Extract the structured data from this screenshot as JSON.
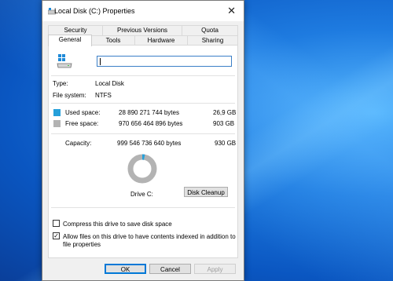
{
  "window": {
    "title": "Local Disk (C:) Properties"
  },
  "tabs_row1": [
    "Security",
    "Previous Versions",
    "Quota"
  ],
  "tabs_row2": [
    "General",
    "Tools",
    "Hardware",
    "Sharing"
  ],
  "general": {
    "name_value": "",
    "type_label": "Type:",
    "type_value": "Local Disk",
    "fs_label": "File system:",
    "fs_value": "NTFS",
    "used_label": "Used space:",
    "used_bytes": "28 890 271 744 bytes",
    "used_gb": "26,9 GB",
    "free_label": "Free space:",
    "free_bytes": "970 656 464 896 bytes",
    "free_gb": "903 GB",
    "capacity_label": "Capacity:",
    "capacity_bytes": "999 546 736 640 bytes",
    "capacity_gb": "930 GB",
    "used_fraction": 0.029,
    "drive_label": "Drive C:",
    "cleanup_label": "Disk Cleanup",
    "compress_label": "Compress this drive to save disk space",
    "compress_checked": false,
    "index_label": "Allow files on this drive to have contents indexed in addition to file properties",
    "index_checked": true
  },
  "buttons": {
    "ok": "OK",
    "cancel": "Cancel",
    "apply": "Apply"
  },
  "colors": {
    "used": "#26a0da",
    "free": "#b3b3b3",
    "accent": "#0078d7"
  }
}
